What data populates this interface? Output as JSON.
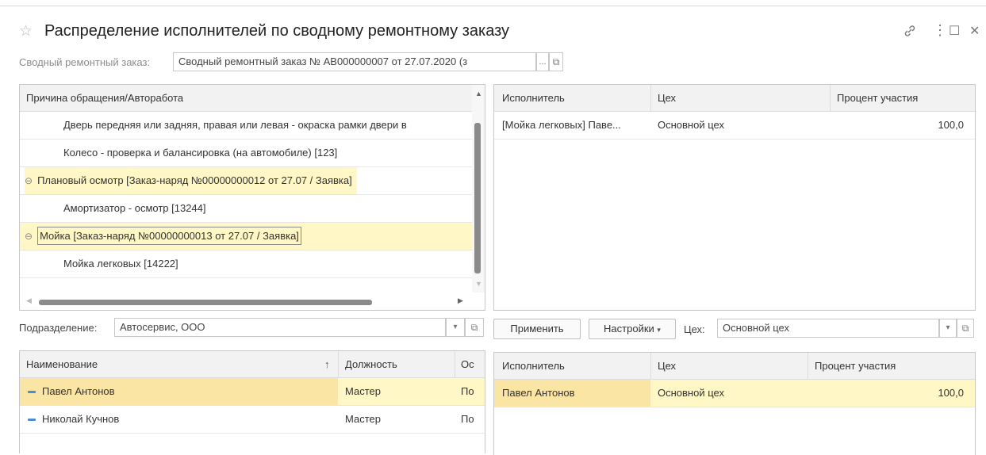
{
  "window": {
    "title": "Распределение исполнителей по сводному ремонтному заказу",
    "star_icon": "☆",
    "link_icon": "🔗",
    "more_icon": "⋮",
    "maximize_icon": "☐",
    "close_icon": "✕"
  },
  "summary_order": {
    "label": "Сводный ремонтный заказ:",
    "value": "Сводный ремонтный заказ № АВ000000007 от 27.07.2020 (з",
    "select_btn": "...",
    "open_icon": "⧉"
  },
  "works_table": {
    "header": "Причина обращения/Авторабота",
    "rows": [
      {
        "text": "Дверь передняя или задняя, правая или левая - окраска рамки двери в",
        "level": 2
      },
      {
        "text": "Колесо - проверка и балансировка (на автомобиле) [123]",
        "level": 2
      },
      {
        "text": "Плановый осмотр [Заказ-наряд №00000000012 от 27.07 / Заявка]",
        "level": 1,
        "collapse": "⊖"
      },
      {
        "text": "Амортизатор - осмотр [13244]",
        "level": 2
      },
      {
        "text": "Мойка [Заказ-наряд №00000000013 от 27.07 / Заявка]",
        "level": 1,
        "collapse": "⊖"
      },
      {
        "text": "Мойка легковых [14222]",
        "level": 2
      }
    ]
  },
  "assigned_table": {
    "headers": [
      "Исполнитель",
      "Цех",
      "Процент участия"
    ],
    "rows": [
      {
        "executor": "[Мойка легковых] Паве...",
        "workshop": "Основной цех",
        "percent": "100,0"
      }
    ]
  },
  "division": {
    "label": "Подразделение:",
    "value": "Автосервис, ООО",
    "dropdown_icon": "▾",
    "open_icon": "⧉"
  },
  "toolbar": {
    "apply": "Применить",
    "settings": "Настройки",
    "settings_caret": "▾",
    "workshop_label": "Цех:",
    "workshop_value": "Основной цех",
    "dropdown_icon": "▾",
    "open_icon": "⧉"
  },
  "employees_table": {
    "headers": [
      "Наименование",
      "Должность",
      "Ос"
    ],
    "sort_icon": "↑",
    "rows": [
      {
        "name": "Павел Антонов",
        "position": "Мастер",
        "extra": "По"
      },
      {
        "name": "Николай Кучнов",
        "position": "Мастер",
        "extra": "По"
      }
    ]
  },
  "selected_table": {
    "headers": [
      "Исполнитель",
      "Цех",
      "Процент участия"
    ],
    "rows": [
      {
        "executor": "Павел Антонов",
        "workshop": "Основной цех",
        "percent": "100,0"
      }
    ]
  }
}
